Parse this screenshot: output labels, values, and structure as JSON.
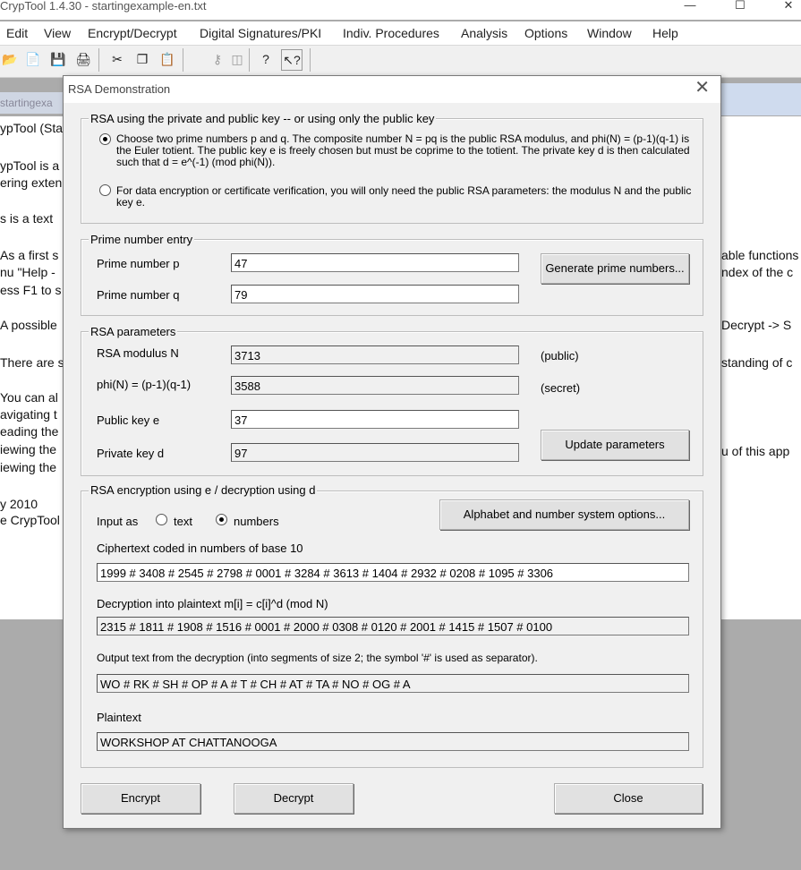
{
  "app": {
    "title": "CrypTool 1.4.30 - startingexample-en.txt",
    "menu": [
      "Edit",
      "View",
      "Encrypt/Decrypt",
      "Digital Signatures/PKI",
      "Indiv. Procedures",
      "Analysis",
      "Options",
      "Window",
      "Help"
    ],
    "document_tab": "startingexa",
    "document_lines": [
      "ypTool (Sta",
      "ypTool is a",
      "ering exten",
      "s is a text",
      "As a first s",
      "nu \"Help -",
      "ess F1 to s",
      "A possible",
      "There are s",
      "You can al",
      "avigating t",
      "eading the",
      "iewing the",
      "iewing the",
      "y 2010",
      "e CrypTool"
    ],
    "document_lines_right": [
      "able functions",
      "ndex of the c",
      "Decrypt -> S",
      "standing of c",
      "u of this app"
    ]
  },
  "dialog": {
    "title": "RSA Demonstration",
    "mode_group": {
      "legend": "RSA using the private and public key -- or using only the public key",
      "option_private": "Choose two prime numbers p and q. The composite number N = pq is the public RSA modulus, and phi(N) = (p-1)(q-1) is the Euler totient. The public key e is freely chosen but must be coprime to the totient. The private key d is then calculated such that d = e^(-1) (mod phi(N)).",
      "option_public": "For data encryption or certificate verification, you will only need the public RSA parameters: the modulus N and the public key e.",
      "selected": "private"
    },
    "prime_group": {
      "legend": "Prime number entry",
      "p_label": "Prime number p",
      "p_value": "47",
      "q_label": "Prime number q",
      "q_value": "79",
      "generate_button": "Generate prime numbers..."
    },
    "params_group": {
      "legend": "RSA parameters",
      "n_label": "RSA modulus N",
      "n_value": "3713",
      "n_note": "(public)",
      "phi_label": "phi(N) = (p-1)(q-1)",
      "phi_value": "3588",
      "phi_note": "(secret)",
      "e_label": "Public key e",
      "e_value": "37",
      "d_label": "Private key d",
      "d_value": "97",
      "update_button": "Update parameters"
    },
    "crypt_group": {
      "legend": "RSA encryption using e / decryption using d",
      "input_as_label": "Input as",
      "input_text_option": "text",
      "input_numbers_option": "numbers",
      "input_selected": "numbers",
      "alphabet_button": "Alphabet and number system options...",
      "cipher_label": "Ciphertext coded in numbers of base 10",
      "cipher_value": "1999 # 3408 # 2545 # 2798 # 0001 # 3284 # 3613 # 1404 # 2932 # 0208 # 1095 # 3306",
      "decrypt_label": "Decryption into plaintext m[i] = c[i]^d (mod N)",
      "decrypt_value": "2315 # 1811 # 1908 # 1516 # 0001 # 2000 # 0308 # 0120 # 2001 # 1415 # 1507 # 0100",
      "output_label": "Output text from the decryption (into segments of size 2; the symbol '#' is used as separator).",
      "output_value": "WO # RK # SH # OP #  A # T  # CH # AT # TA # NO # OG # A",
      "plaintext_label": "Plaintext",
      "plaintext_value": "WORKSHOP AT CHATTANOOGA"
    },
    "buttons": {
      "encrypt": "Encrypt",
      "decrypt": "Decrypt",
      "close": "Close"
    }
  }
}
